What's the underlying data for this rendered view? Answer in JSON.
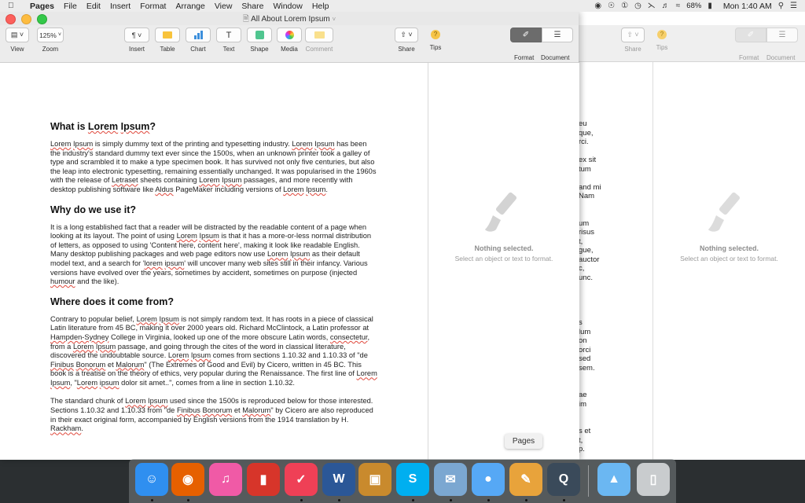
{
  "menubar": {
    "app_name": "Pages",
    "items": [
      "File",
      "Edit",
      "Insert",
      "Format",
      "Arrange",
      "View",
      "Share",
      "Window",
      "Help"
    ],
    "battery": "68%",
    "clock": "Mon 1:40 AM"
  },
  "window": {
    "title": "All About Lorem Ipsum",
    "toolbar": {
      "view_label": "View",
      "zoom_value": "125%",
      "zoom_label": "Zoom",
      "insert_label": "Insert",
      "table_label": "Table",
      "chart_label": "Chart",
      "text_label": "Text",
      "shape_label": "Shape",
      "media_label": "Media",
      "comment_label": "Comment",
      "share_label": "Share",
      "tips_label": "Tips",
      "format_label": "Format",
      "document_label": "Document"
    }
  },
  "document": {
    "sections": [
      {
        "heading": "What is Lorem Ipsum?",
        "paragraphs": [
          "Lorem Ipsum is simply dummy text of the printing and typesetting industry. Lorem Ipsum has been the industry's standard dummy text ever since the 1500s, when an unknown printer took a galley of type and scrambled it to make a type specimen book. It has survived not only five centuries, but also the leap into electronic typesetting, remaining essentially unchanged. It was popularised in the 1960s with the release of Letraset sheets containing Lorem Ipsum passages, and more recently with desktop publishing software like Aldus PageMaker including versions of Lorem Ipsum."
        ]
      },
      {
        "heading": "Why do we use it?",
        "paragraphs": [
          "It is a long established fact that a reader will be distracted by the readable content of a page when looking at its layout. The point of using Lorem Ipsum is that it has a more-or-less normal distribution of letters, as opposed to using 'Content here, content here', making it look like readable English. Many desktop publishing packages and web page editors now use Lorem Ipsum as their default model text, and a search for 'lorem ipsum' will uncover many web sites still in their infancy. Various versions have evolved over the years, sometimes by accident, sometimes on purpose (injected humour and the like)."
        ]
      },
      {
        "heading": "Where does it come from?",
        "paragraphs": [
          "Contrary to popular belief, Lorem Ipsum is not simply random text. It has roots in a piece of classical Latin literature from 45 BC, making it over 2000 years old. Richard McClintock, a Latin professor at Hampden-Sydney College in Virginia, looked up one of the more obscure Latin words, consectetur, from a Lorem Ipsum passage, and going through the cites of the word in classical literature, discovered the undoubtable source. Lorem Ipsum comes from sections 1.10.32 and 1.10.33 of \"de Finibus Bonorum et Malorum\" (The Extremes of Good and Evil) by Cicero, written in 45 BC. This book is a treatise on the theory of ethics, very popular during the Renaissance. The first line of Lorem Ipsum, \"Lorem ipsum dolor sit amet..\", comes from a line in section 1.10.32.",
          "The standard chunk of Lorem Ipsum used since the 1500s is reproduced below for those interested. Sections 1.10.32 and 1.10.33 from \"de Finibus Bonorum et Malorum\" by Cicero are also reproduced in their exact original form, accompanied by English versions from the 1914 translation by H. Rackham."
        ]
      }
    ]
  },
  "sidebar": {
    "title": "Nothing selected.",
    "subtitle": "Select an object or text to format."
  },
  "background_window": {
    "toolbar": {
      "share_label": "Share",
      "tips_label": "Tips",
      "format_label": "Format",
      "document_label": "Document"
    },
    "sidebar": {
      "title": "Nothing selected.",
      "subtitle": "Select an object or text to format."
    },
    "peek_text": [
      "eu",
      "que,",
      "rci.",
      "",
      "ex sit",
      "tum",
      "",
      "and mi",
      "Nam",
      "",
      "",
      "um",
      "risus",
      "t,",
      "gue,",
      "auctor",
      "c,",
      "unc.",
      "",
      "",
      "",
      "",
      "s",
      "lum",
      "on",
      "orci",
      "sed",
      "sem.",
      "",
      "",
      "ae",
      "im",
      "",
      "",
      "s et",
      "t,",
      "p."
    ]
  },
  "dock": {
    "tooltip": "Pages",
    "apps": [
      {
        "name": "finder-icon",
        "color": "#2f8ff0"
      },
      {
        "name": "firefox-icon",
        "color": "#e66000"
      },
      {
        "name": "itunes-icon",
        "color": "#f05aa6"
      },
      {
        "name": "parallels-icon",
        "color": "#d7352a"
      },
      {
        "name": "pocket-icon",
        "color": "#ef4056"
      },
      {
        "name": "word-icon",
        "color": "#2b5797"
      },
      {
        "name": "preview-icon",
        "color": "#c98a2d"
      },
      {
        "name": "skype-icon",
        "color": "#00aff0"
      },
      {
        "name": "mail-icon",
        "color": "#7ba7d1"
      },
      {
        "name": "messages-icon",
        "color": "#56a8f5"
      },
      {
        "name": "pages-icon",
        "color": "#e8a33b"
      },
      {
        "name": "quicktime-icon",
        "color": "#3a4a5a"
      },
      {
        "name": "folder-icon",
        "color": "#6bb7f2"
      },
      {
        "name": "trash-icon",
        "color": "#c9ccce"
      }
    ]
  }
}
